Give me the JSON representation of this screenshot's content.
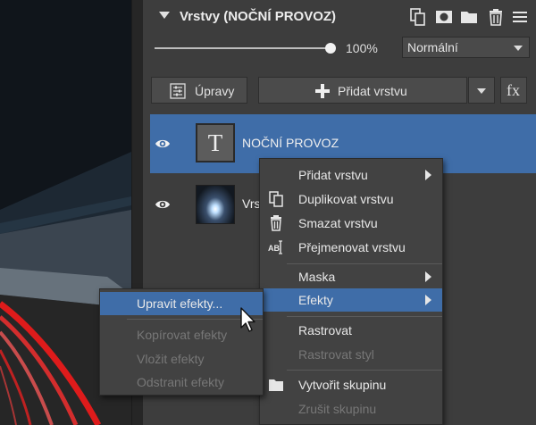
{
  "panel": {
    "title": "Vrstvy (NOČNÍ PROVOZ)",
    "header_icons": [
      "duplicate-layer-icon",
      "mask-icon",
      "folder-icon",
      "trash-icon",
      "menu-icon"
    ],
    "opacity": {
      "value": 100,
      "label": "100%"
    },
    "blend_mode": {
      "selected": "Normální"
    },
    "buttons": {
      "adjustments": "Úpravy",
      "add_layer": "Přidat vrstvu",
      "fx": "fx"
    }
  },
  "layers": [
    {
      "name": "NOČNÍ PROVOZ",
      "thumb_text": "T",
      "selected": true
    },
    {
      "name": "Vrs",
      "selected": false
    }
  ],
  "context_menu": {
    "items": [
      {
        "label": "Přidat vrstvu"
      },
      {
        "label": "Duplikovat vrstvu"
      },
      {
        "label": "Smazat vrstvu"
      },
      {
        "label": "Přejmenovat vrstvu"
      },
      {
        "label": "Maska"
      },
      {
        "label": "Efekty"
      },
      {
        "label": "Rastrovat"
      },
      {
        "label": "Rastrovat styl"
      },
      {
        "label": "Vytvořit skupinu"
      },
      {
        "label": "Zrušit skupinu"
      }
    ]
  },
  "effects_submenu": {
    "items": [
      {
        "label": "Upravit efekty..."
      },
      {
        "label": "Kopírovat efekty"
      },
      {
        "label": "Vložit efekty"
      },
      {
        "label": "Odstranit efekty"
      }
    ]
  },
  "colors": {
    "selection": "#3f6da8",
    "panel_bg": "#3d3d3d",
    "menu_bg": "#424242",
    "disabled_text": "#777777"
  }
}
